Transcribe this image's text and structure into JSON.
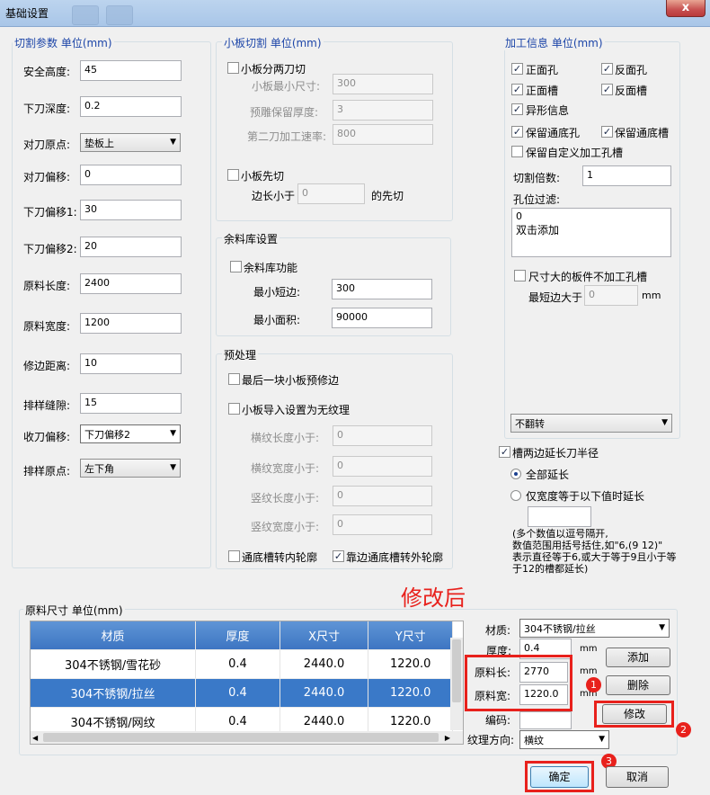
{
  "window": {
    "title": "基础设置",
    "close_label": "x"
  },
  "cut_params": {
    "title": "切割参数 单位(mm)",
    "fields": [
      {
        "label": "安全高度:",
        "value": "45"
      },
      {
        "label": "下刀深度:",
        "value": "0.2"
      },
      {
        "label": "对刀原点:",
        "value": "垫板上"
      },
      {
        "label": "对刀偏移:",
        "value": "0"
      },
      {
        "label": "下刀偏移1:",
        "value": "30"
      },
      {
        "label": "下刀偏移2:",
        "value": "20"
      },
      {
        "label": "原料长度:",
        "value": "2400"
      },
      {
        "label": "原料宽度:",
        "value": "1200"
      },
      {
        "label": "修边距离:",
        "value": "10"
      },
      {
        "label": "排样缝隙:",
        "value": "15"
      },
      {
        "label": "收刀偏移:",
        "value": "下刀偏移2"
      },
      {
        "label": "排样原点:",
        "value": "左下角"
      }
    ]
  },
  "small_board": {
    "title": "小板切割 单位(mm)",
    "two_cut": {
      "label": "小板分两刀切",
      "checked": false
    },
    "min_size": {
      "label": "小板最小尺寸:",
      "value": "300"
    },
    "keep_thickness": {
      "label": "预雕保留厚度:",
      "value": "3"
    },
    "second_speed": {
      "label": "第二刀加工速率:",
      "value": "800"
    },
    "first_cut": {
      "label": "小板先切",
      "checked": false
    },
    "edge_less": {
      "label": "边长小于",
      "value": "0",
      "suffix": "的先切"
    }
  },
  "remnant": {
    "title": "余料库设置",
    "enable": {
      "label": "余料库功能",
      "checked": false
    },
    "min_edge": {
      "label": "最小短边:",
      "value": "300"
    },
    "min_area": {
      "label": "最小面积:",
      "value": "90000"
    }
  },
  "preprocess": {
    "title": "预处理",
    "last_trim": {
      "label": "最后一块小板预修边",
      "checked": false
    },
    "no_texture": {
      "label": "小板导入设置为无纹理",
      "checked": false
    },
    "fields": [
      {
        "label": "横纹长度小于:",
        "value": "0"
      },
      {
        "label": "横纹宽度小于:",
        "value": "0"
      },
      {
        "label": "竖纹长度小于:",
        "value": "0"
      },
      {
        "label": "竖纹宽度小于:",
        "value": "0"
      }
    ],
    "inner_contour": {
      "label": "通底槽转内轮廓",
      "checked": false
    },
    "outer_contour": {
      "label": "靠边通底槽转外轮廓",
      "checked": true
    }
  },
  "process_info": {
    "title": "加工信息 单位(mm)",
    "checks": [
      {
        "label": "正面孔",
        "checked": true
      },
      {
        "label": "反面孔",
        "checked": true
      },
      {
        "label": "正面槽",
        "checked": true
      },
      {
        "label": "反面槽",
        "checked": true
      },
      {
        "label": "异形信息",
        "checked": true
      },
      {
        "label": "保留通底孔",
        "checked": true
      },
      {
        "label": "保留通底槽",
        "checked": true
      },
      {
        "label": "保留自定义加工孔槽",
        "checked": false
      }
    ],
    "cut_multiple": {
      "label": "切割倍数:",
      "value": "1"
    },
    "hole_filter": {
      "label": "孔位过滤:",
      "line1": "0",
      "line2": "双击添加"
    },
    "oversize": {
      "label": "尺寸大的板件不加工孔槽",
      "checked": false
    },
    "min_edge": {
      "label": "最短边大于",
      "value": "0",
      "unit": "mm"
    },
    "flip": {
      "value": "不翻转"
    }
  },
  "slot_extend": {
    "label": "槽两边延长刀半径",
    "checked": true,
    "opt_all": "全部延长",
    "opt_width": "仅宽度等于以下值时延长",
    "note": [
      "(多个数值以逗号隔开,",
      "数值范围用括号括住,如\"6,(9 12)\"",
      "表示直径等于6,或大于等于9且小于等",
      "于12的槽都延长)"
    ]
  },
  "annotation": {
    "text": "修改后",
    "badges": [
      "1",
      "2",
      "3"
    ]
  },
  "raw_size": {
    "title": "原料尺寸 单位(mm)",
    "columns": [
      "材质",
      "厚度",
      "X尺寸",
      "Y尺寸"
    ],
    "rows": [
      {
        "material": "304不锈钢/雪花砂",
        "thickness": "0.4",
        "x": "2440.0",
        "y": "1220.0"
      },
      {
        "material": "304不锈钢/拉丝",
        "thickness": "0.4",
        "x": "2440.0",
        "y": "1220.0"
      },
      {
        "material": "304不锈钢/网纹",
        "thickness": "0.4",
        "x": "2440.0",
        "y": "1220.0"
      }
    ],
    "material": {
      "label": "材质:",
      "value": "304不锈钢/拉丝"
    },
    "thickness": {
      "label": "厚度:",
      "value": "0.4",
      "unit": "mm"
    },
    "length": {
      "label": "原料长:",
      "value": "2770",
      "unit": "mm"
    },
    "width": {
      "label": "原料宽:",
      "value": "1220.0",
      "unit": "mm"
    },
    "code": {
      "label": "编码:",
      "value": ""
    },
    "texture": {
      "label": "纹理方向:",
      "value": "横纹"
    },
    "add_label": "添加",
    "delete_label": "删除",
    "modify_label": "修改"
  },
  "footer": {
    "ok_label": "确定",
    "cancel_label": "取消"
  }
}
